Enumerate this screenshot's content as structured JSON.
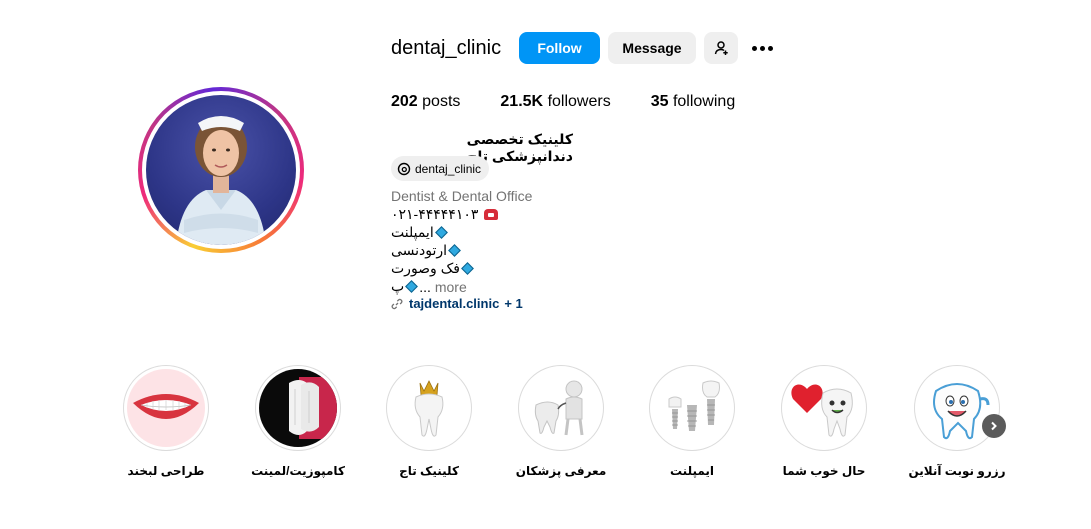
{
  "profile": {
    "username": "dentaj_clinic",
    "follow_label": "Follow",
    "message_label": "Message",
    "stats": {
      "posts_count": "202",
      "posts_label": "posts",
      "followers_count": "21.5K",
      "followers_label": "followers",
      "following_count": "35",
      "following_label": "following"
    },
    "full_name": "کلینیک تخصصی دندانپزشکی تاج",
    "threads_handle": "dentaj_clinic",
    "category": "Dentist & Dental Office",
    "bio": {
      "phone": "۰۲۱-۴۴۴۴۴۱۰۳",
      "line1": "ایمپلنت",
      "line2": "ارتودنسی",
      "line3": "فک وصورت",
      "line4": "پ",
      "ellipsis": "...",
      "more_label": "more"
    },
    "link": {
      "text": "tajdental.clinic",
      "extra": "+ 1"
    }
  },
  "highlights": [
    {
      "label": "طراحی لبخند",
      "icon": "smile-teeth-icon"
    },
    {
      "label": "کامپوزیت/لمینت",
      "icon": "veneer-teeth-icon"
    },
    {
      "label": "کلینیک تاج",
      "icon": "crowned-tooth-icon"
    },
    {
      "label": "معرفی پزشکان",
      "icon": "tooth-doctor-icon"
    },
    {
      "label": "ایمپلنت",
      "icon": "implant-icon"
    },
    {
      "label": "حال خوب شما",
      "icon": "tooth-heart-icon"
    },
    {
      "label": "رزرو نوبت آنلاین",
      "icon": "happy-tooth-icon"
    }
  ],
  "colors": {
    "follow_blue": "#0095f6",
    "link_blue": "#00376b",
    "secondary_gray": "#737373",
    "button_gray": "#efefef"
  }
}
